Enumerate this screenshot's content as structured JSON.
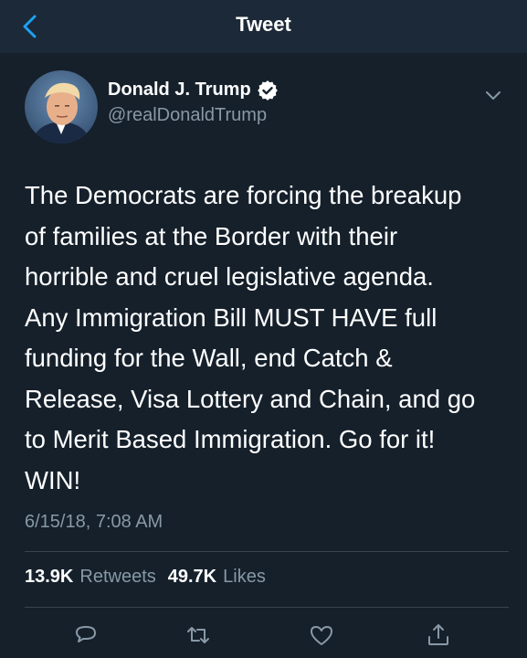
{
  "navbar": {
    "title": "Tweet",
    "back_icon": "chevron-left-icon"
  },
  "colors": {
    "background": "#15202b",
    "navbar": "#1c2938",
    "accent": "#1da1f2",
    "muted": "#8899a6"
  },
  "author": {
    "name": "Donald J. Trump",
    "handle": "@realDonaldTrump",
    "verified_icon": "verified-badge-icon"
  },
  "tweet": {
    "text": "The Democrats are forcing the breakup\nof families at the Border with their\nhorrible and cruel legislative agenda.\nAny Immigration Bill MUST HAVE full\nfunding for the Wall, end Catch &\nRelease, Visa Lottery and Chain, and go\nto Merit Based Immigration. Go for it!\nWIN!",
    "timestamp": "6/15/18, 7:08 AM"
  },
  "stats": {
    "retweets_count": "13.9K",
    "retweets_label": "Retweets",
    "likes_count": "49.7K",
    "likes_label": "Likes"
  },
  "actions": [
    "reply-icon",
    "retweet-icon",
    "like-icon",
    "share-icon"
  ]
}
